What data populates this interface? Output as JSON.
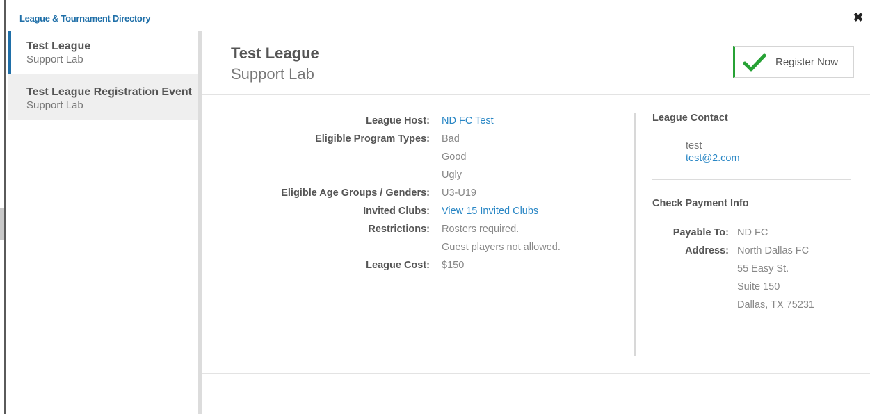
{
  "app": {
    "title": "League & Tournament Directory"
  },
  "sidebar": {
    "items": [
      {
        "name": "Test League",
        "sub": "Support Lab",
        "active": true
      },
      {
        "name": "Test League Registration Event",
        "sub": "Support Lab",
        "active": false
      }
    ]
  },
  "header": {
    "title": "Test League",
    "subtitle": "Support Lab",
    "register_label": "Register Now"
  },
  "details": {
    "host_label": "League Host:",
    "host_value": "ND FC Test",
    "program_label": "Eligible Program Types:",
    "program_values": [
      "Bad",
      "Good",
      "Ugly"
    ],
    "age_label": "Eligible Age Groups / Genders:",
    "age_value": "U3-U19",
    "clubs_label": "Invited Clubs:",
    "clubs_value": "View 15 Invited Clubs",
    "restrictions_label": "Restrictions:",
    "restrictions_values": [
      "Rosters required.",
      "Guest players not allowed."
    ],
    "cost_label": "League Cost:",
    "cost_value": "$150"
  },
  "contact": {
    "title": "League Contact",
    "name": "test",
    "email": "test@2.com"
  },
  "payment": {
    "title": "Check Payment Info",
    "payable_label": "Payable To:",
    "payable_value": "ND FC",
    "address_label": "Address:",
    "address_lines": [
      "North Dallas FC",
      "55 Easy St.",
      "Suite 150",
      "Dallas, TX 75231"
    ]
  },
  "colors": {
    "accent": "#1f6fa8",
    "link": "#2a87c5",
    "success": "#27a235"
  }
}
